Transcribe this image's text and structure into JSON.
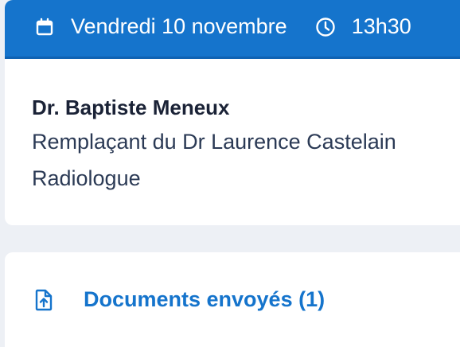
{
  "appointment": {
    "date": "Vendredi 10 novembre",
    "time": "13h30",
    "icons": {
      "date": "calendar-icon",
      "time": "clock-icon"
    },
    "colors": {
      "header_bg": "#1574cc",
      "header_text": "#ffffff"
    }
  },
  "doctor": {
    "name": "Dr. Baptiste Meneux",
    "replacement": "Remplaçant du Dr Laurence Castelain",
    "specialty": "Radiologue"
  },
  "documents": {
    "label": "Documents envoyés (1)",
    "icon": "file-upload-icon",
    "color": "#1574cc"
  }
}
